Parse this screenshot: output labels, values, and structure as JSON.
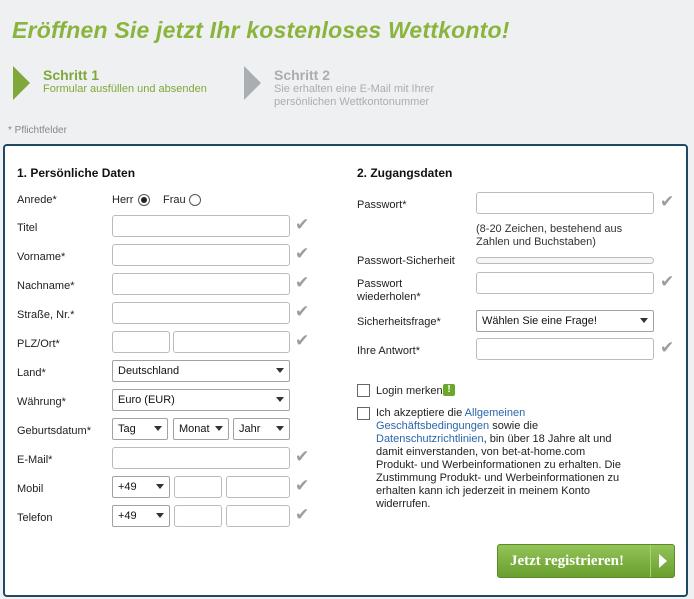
{
  "header": {
    "title": "Eröffnen Sie jetzt Ihr kostenloses Wettkonto!",
    "step1_title": "Schritt 1",
    "step1_sub": "Formular ausfüllen und absenden",
    "step2_title": "Schritt 2",
    "step2_sub_line1": "Sie erhalten eine E-Mail mit Ihrer",
    "step2_sub_line2": "persönlichen Wettkontonummer",
    "required_note": "* Pflichtfelder"
  },
  "personal": {
    "title": "1. Persönliche Daten",
    "salutation_label": "Anrede*",
    "salutation_mr": "Herr",
    "salutation_mrs": "Frau",
    "title_label": "Titel",
    "firstname_label": "Vorname*",
    "lastname_label": "Nachname*",
    "street_label": "Straße, Nr.*",
    "zip_city_label": "PLZ/Ort*",
    "country_label": "Land*",
    "country_value": "Deutschland",
    "currency_label": "Währung*",
    "currency_value": "Euro (EUR)",
    "birthdate_label": "Geburtsdatum*",
    "day_value": "Tag",
    "month_value": "Monat",
    "year_value": "Jahr",
    "email_label": "E-Mail*",
    "mobile_label": "Mobil",
    "mobile_code": "+49",
    "phone_label": "Telefon",
    "phone_code": "+49"
  },
  "access": {
    "title": "2. Zugangsdaten",
    "password_label": "Passwort*",
    "password_hint_line1": "(8-20 Zeichen, bestehend aus",
    "password_hint_line2": "Zahlen und Buchstaben)",
    "strength_label": "Passwort-Sicherheit",
    "repeat_label_line1": "Passwort",
    "repeat_label_line2": "wiederholen*",
    "question_label": "Sicherheitsfrage*",
    "question_value": "Wählen Sie eine Frage!",
    "answer_label": "Ihre Antwort*",
    "remember_label": "Login merken",
    "info_icon_text": "!",
    "accept_l1_a": "Ich akzeptiere die ",
    "accept_l1_link": "Allgemeinen",
    "accept_l2_link": "Geschäftsbedingungen",
    "accept_l2_b": " sowie die",
    "accept_l3_link": "Datenschutzrichtlinien",
    "accept_l3_b": ", bin über 18 Jahre alt und",
    "accept_l4": "damit einverstanden, von bet-at-home.com",
    "accept_l5": "Produkt- und Werbeinformationen zu erhalten. Die",
    "accept_l6": "Zustimmung Produkt- und Werbeinformationen zu",
    "accept_l7": "erhalten kann ich jederzeit in meinem Konto",
    "accept_l8": "widerrufen."
  },
  "submit_label": "Jetzt registrieren!",
  "colors": {
    "brand_green": "#8ab43e",
    "frame_blue": "#1f4a67",
    "link_blue": "#2a66a8",
    "inactive_gray": "#a9aeb2"
  },
  "icons": {
    "valid": "check-icon",
    "step": "arrow-right-icon",
    "info": "info-icon",
    "submit": "play-icon"
  }
}
